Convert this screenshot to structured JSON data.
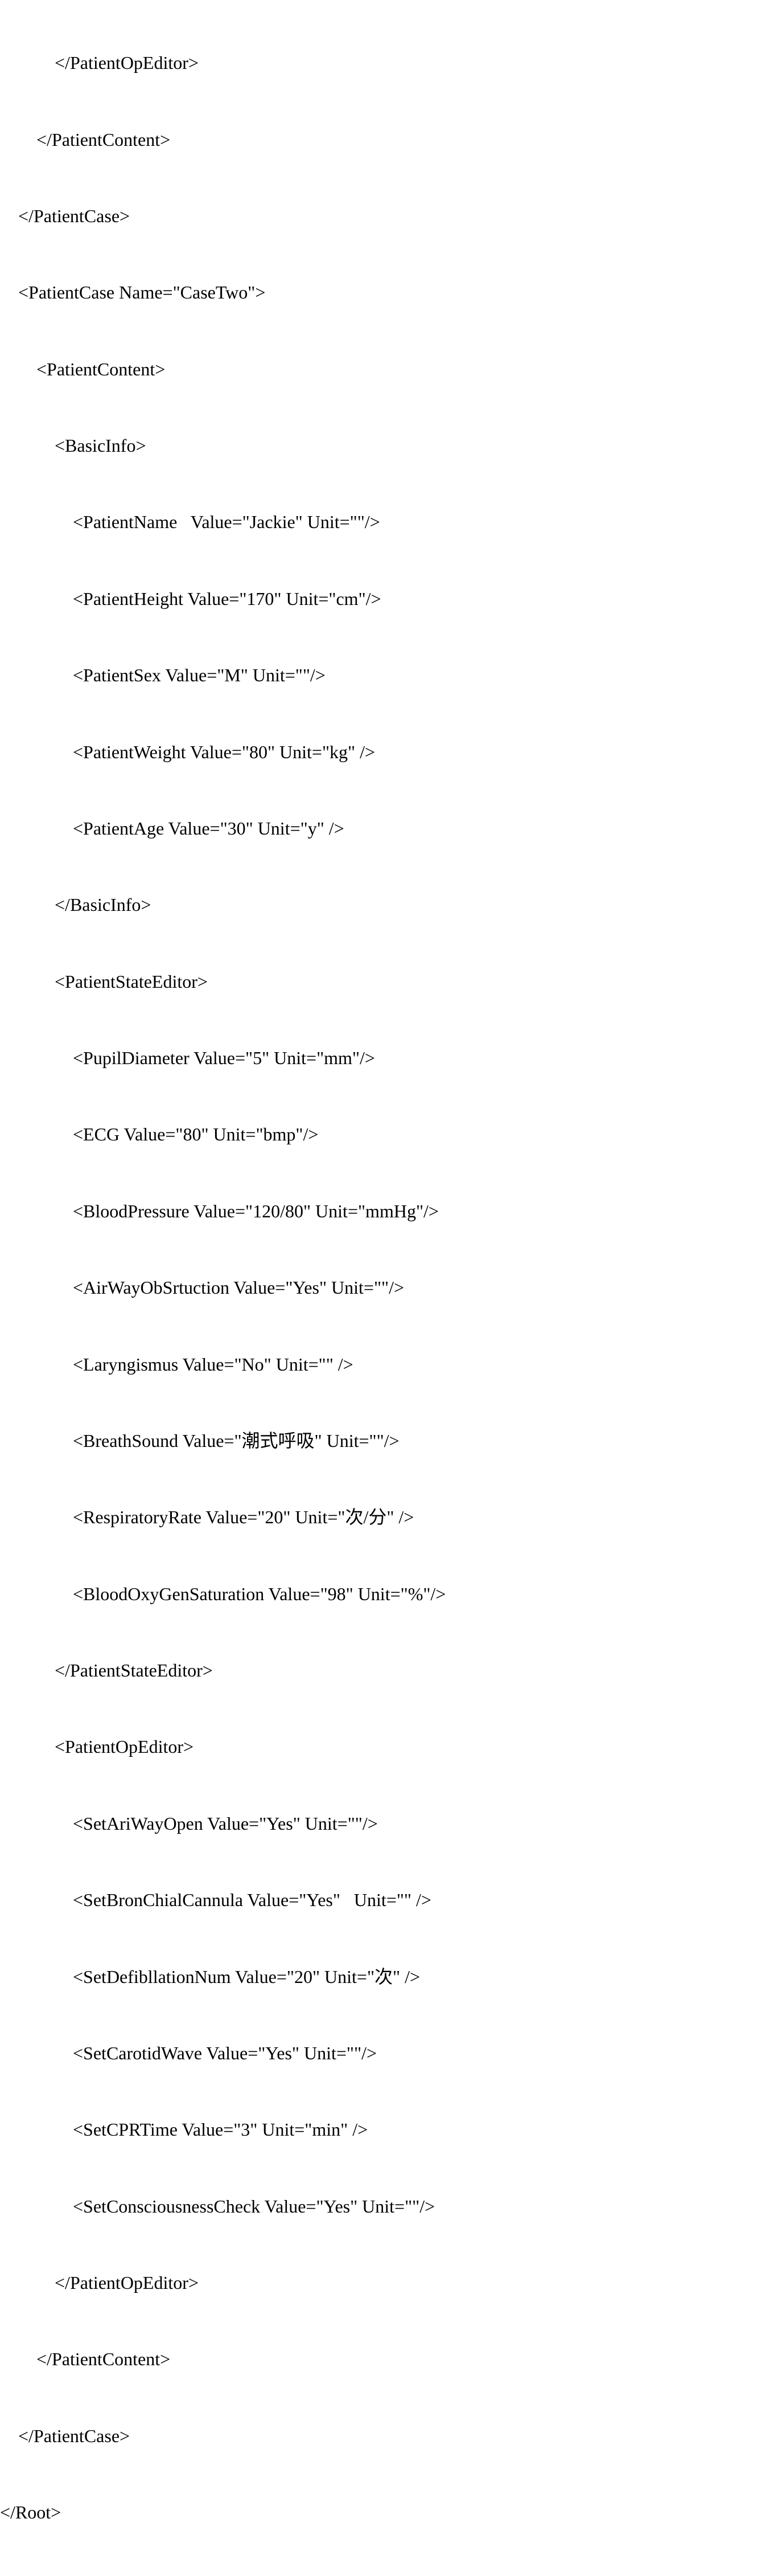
{
  "lines": [
    "            </PatientOpEditor>",
    "        </PatientContent>",
    "    </PatientCase>",
    "    <PatientCase Name=\"CaseTwo\">",
    "        <PatientContent>",
    "            <BasicInfo>",
    "                <PatientName   Value=\"Jackie\" Unit=\"\"/>",
    "                <PatientHeight Value=\"170\" Unit=\"cm\"/>",
    "                <PatientSex Value=\"M\" Unit=\"\"/>",
    "                <PatientWeight Value=\"80\" Unit=\"kg\" />",
    "                <PatientAge Value=\"30\" Unit=\"y\" />",
    "            </BasicInfo>",
    "            <PatientStateEditor>",
    "                <PupilDiameter Value=\"5\" Unit=\"mm\"/>",
    "                <ECG Value=\"80\" Unit=\"bmp\"/>",
    "                <BloodPressure Value=\"120/80\" Unit=\"mmHg\"/>",
    "                <AirWayObSrtuction Value=\"Yes\" Unit=\"\"/>",
    "                <Laryngismus Value=\"No\" Unit=\"\" />",
    "                <BreathSound Value=\"潮式呼吸\" Unit=\"\"/>",
    "                <RespiratoryRate Value=\"20\" Unit=\"次/分\" />",
    "                <BloodOxyGenSaturation Value=\"98\" Unit=\"%\"/>",
    "            </PatientStateEditor>",
    "            <PatientOpEditor>",
    "                <SetAriWayOpen Value=\"Yes\" Unit=\"\"/>",
    "                <SetBronChialCannula Value=\"Yes\"   Unit=\"\" />",
    "                <SetDefibllationNum Value=\"20\" Unit=\"次\" />",
    "                <SetCarotidWave Value=\"Yes\" Unit=\"\"/>",
    "                <SetCPRTime Value=\"3\" Unit=\"min\" />",
    "                <SetConsciousnessCheck Value=\"Yes\" Unit=\"\"/>",
    "            </PatientOpEditor>",
    "        </PatientContent>",
    "    </PatientCase>",
    "</Root>"
  ]
}
